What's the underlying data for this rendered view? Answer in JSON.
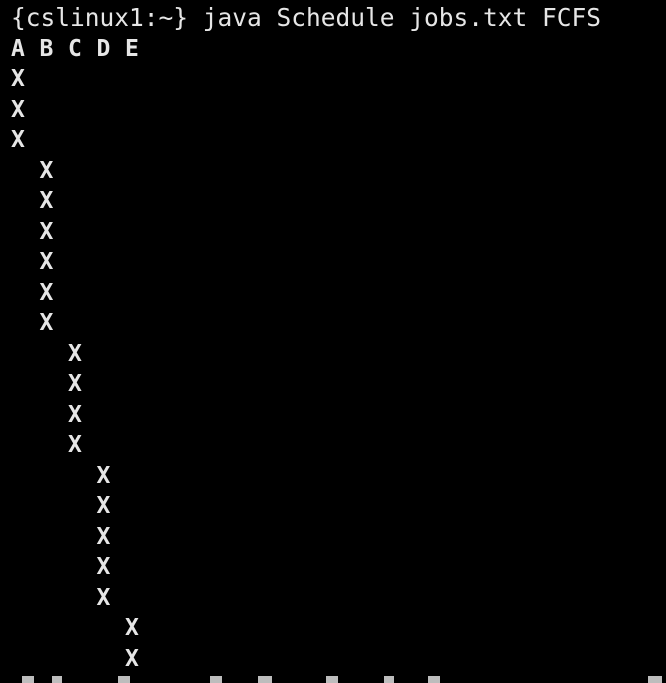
{
  "terminal": {
    "colors": {
      "background": "#000000",
      "text": "#e6e6e6"
    },
    "partial_top_line": "  x",
    "command_line": "{cslinux1:~} java Schedule jobs.txt FCFS",
    "header_line": "A B C D E",
    "schedule_rows": [
      "X",
      "X",
      "X",
      "  X",
      "  X",
      "  X",
      "  X",
      "  X",
      "  X",
      "    X",
      "    X",
      "    X",
      "    X",
      "      X",
      "      X",
      "      X",
      "      X",
      "      X",
      "        X",
      "        X"
    ]
  }
}
